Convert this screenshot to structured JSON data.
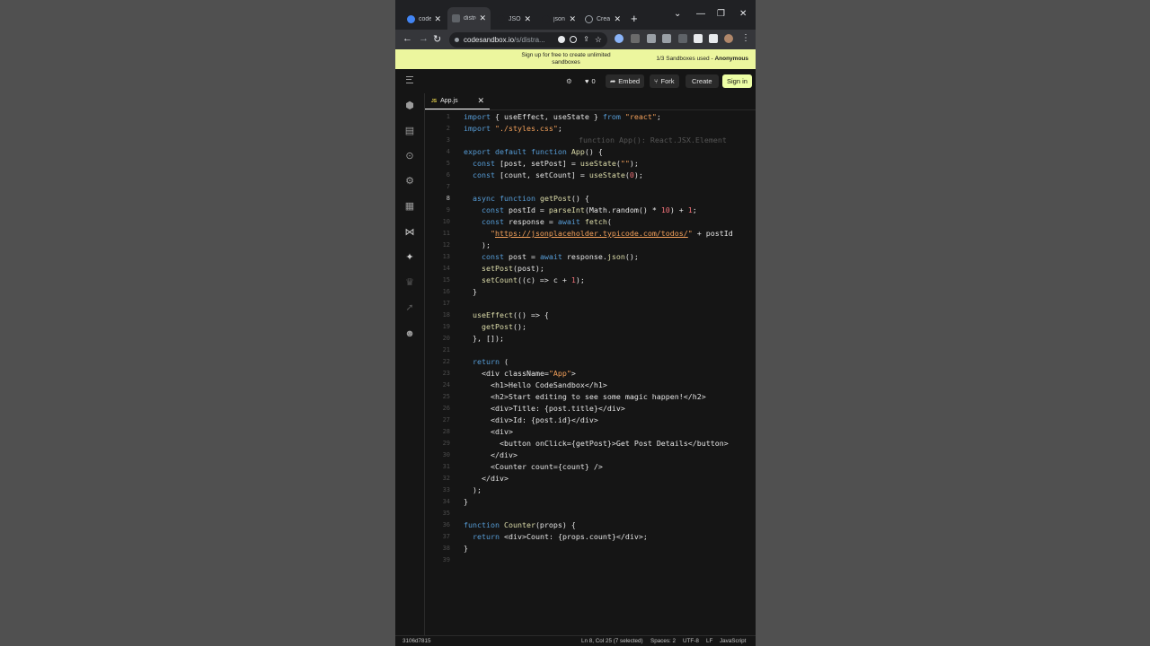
{
  "browser": {
    "tabs": [
      {
        "label": "code",
        "fav": "#4285f4"
      },
      {
        "label": "distro",
        "fav": "#3c4043"
      },
      {
        "label": "JSON",
        "fav": "#202124"
      },
      {
        "label": "json",
        "fav": "#202124"
      },
      {
        "label": "Crea",
        "fav": "#5f6368"
      }
    ],
    "new_tab": "+",
    "window_controls": [
      "⌄",
      "—",
      "❐",
      "✕"
    ],
    "url_host": "codesandbox.io",
    "url_path": "/s/distra..."
  },
  "banner": {
    "message": "Sign up for free to create unlimited sandboxes",
    "usage": "1/3 Sandboxes used - ",
    "user": "Anonymous"
  },
  "header": {
    "likes": "0",
    "embed": "Embed",
    "fork": "Fork",
    "create": "Create",
    "signin": "Sign in"
  },
  "activity_icons": [
    "cube-icon",
    "file-icon",
    "search-icon",
    "gear-icon",
    "docker-icon",
    "vscode-icon",
    "sparkle-icon",
    "trophy-icon",
    "rocket-icon",
    "users-icon"
  ],
  "editor": {
    "tab_label": "App.js",
    "tab_lang": "JS",
    "inline_hint": "function App(): React.JSX.Element",
    "current_line": 8,
    "lines": [
      "import { useEffect, useState } from \"react\";",
      "import \"./styles.css\";",
      "",
      "export default function App() {",
      "  const [post, setPost] = useState(\"\");",
      "  const [count, setCount] = useState(0);",
      "",
      "  async function getPost() {",
      "    const postId = parseInt(Math.random() * 10) + 1;",
      "    const response = await fetch(",
      "      \"https://jsonplaceholder.typicode.com/todos/\" + postId",
      "    );",
      "    const post = await response.json();",
      "    setPost(post);",
      "    setCount((c) => c + 1);",
      "  }",
      "",
      "  useEffect(() => {",
      "    getPost();",
      "  }, []);",
      "",
      "  return (",
      "    <div className=\"App\">",
      "      <h1>Hello CodeSandbox</h1>",
      "      <h2>Start editing to see some magic happen!</h2>",
      "      <div>Title: {post.title}</div>",
      "      <div>Id: {post.id}</div>",
      "      <div>",
      "        <button onClick={getPost}>Get Post Details</button>",
      "      </div>",
      "      <Counter count={count} />",
      "    </div>",
      "  );",
      "}",
      "",
      "function Counter(props) {",
      "  return <div>Count: {props.count}</div>;",
      "}",
      ""
    ]
  },
  "statusbar": {
    "id": "3106d7815",
    "position": "Ln 8, Col 25 (7 selected)",
    "spaces": "Spaces: 2",
    "encoding": "UTF-8",
    "eol": "LF",
    "language": "JavaScript"
  },
  "colors": {
    "keyword": "#569cd6",
    "string": "#f3a05a",
    "fn": "#dcdcaa",
    "banner_bg": "#ecf69e",
    "signin_bg": "#edffa5"
  }
}
